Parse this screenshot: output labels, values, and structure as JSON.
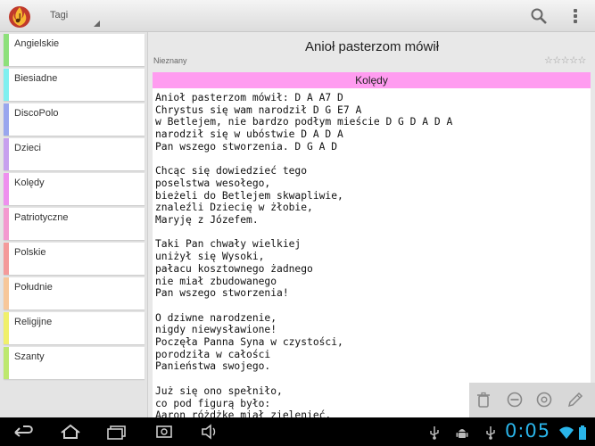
{
  "action_bar": {
    "app_icon": "flame-note-icon",
    "spinner_label": "Tagi",
    "search_icon": "search-icon",
    "overflow_icon": "overflow-menu-icon"
  },
  "sidebar": {
    "items": [
      {
        "label": "Angielskie",
        "color": "#8de07a"
      },
      {
        "label": "Biesiadne",
        "color": "#7ff0f0"
      },
      {
        "label": "DiscoPolo",
        "color": "#99a6ee"
      },
      {
        "label": "Dzieci",
        "color": "#c7a0ee"
      },
      {
        "label": "Kolędy",
        "color": "#ee90ee"
      },
      {
        "label": "Patriotyczne",
        "color": "#f39ad0"
      },
      {
        "label": "Polskie",
        "color": "#f49a9a"
      },
      {
        "label": "Południe",
        "color": "#f7c79a"
      },
      {
        "label": "Religijne",
        "color": "#f0f06a"
      },
      {
        "label": "Szanty",
        "color": "#bde86e"
      }
    ]
  },
  "song": {
    "title": "Anioł pasterzom mówił",
    "author": "Nieznany",
    "rating_stars": "☆☆☆☆☆",
    "category": "Kolędy",
    "category_color": "#ff9cf0",
    "lyrics": "Anioł pasterzom mówił: D A A7 D\nChrystus się wam narodził D G E7 A\nw Betlejem, nie bardzo podłym mieście D G D A D A\nnarodził się w ubóstwie D A D A\nPan wszego stworzenia. D G A D\n\nChcąc się dowiedzieć tego\nposelstwa wesołego,\nbieżeli do Betlejem skwapliwie,\nznaleźli Dziecię w żłobie,\nMaryję z Józefem.\n\nTaki Pan chwały wielkiej\nuniżył się Wysoki,\npałacu kosztownego żadnego\nnie miał zbudowanego\nPan wszego stworzenia!\n\nO dziwne narodzenie,\nnigdy niewysławione!\nPoczęła Panna Syna w czystości,\nporodziła w całości\nPanieństwa swojego.\n\nJuż się ono spełniło,\nco pod figurą było:\nAaron różdżkę miał zielenieć,"
  },
  "song_actions": [
    "trash-icon",
    "remove-circle-icon",
    "settings-circle-icon",
    "pencil-icon"
  ],
  "system_bar": {
    "clock": "0:05",
    "nav": [
      "back-icon",
      "home-icon",
      "recent-apps-icon",
      "volume-icon"
    ],
    "status": [
      "usb-icon",
      "android-debug-icon",
      "usb-icon",
      "wifi-icon",
      "battery-icon"
    ]
  }
}
